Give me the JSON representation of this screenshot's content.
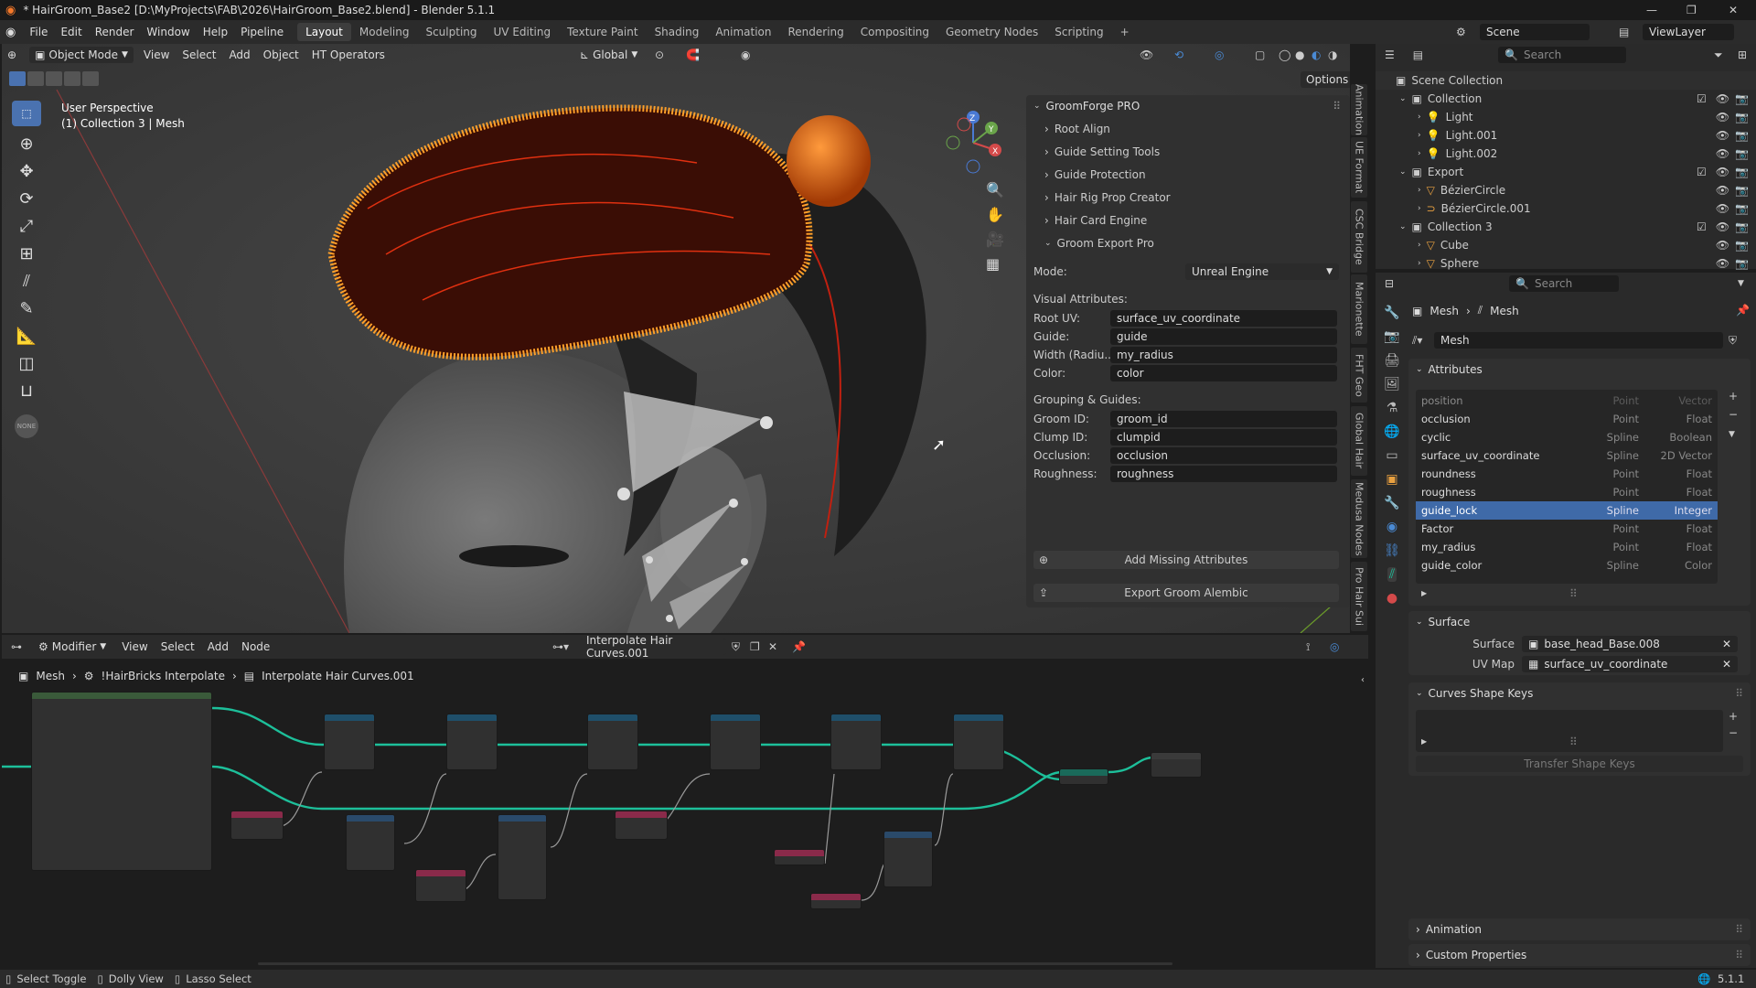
{
  "window": {
    "title": "* HairGroom_Base2 [D:\\MyProjects\\FAB\\2026\\HairGroom_Base2.blend] - Blender 5.1.1"
  },
  "menu": [
    "File",
    "Edit",
    "Render",
    "Window",
    "Help",
    "Pipeline"
  ],
  "workspaces": [
    "Layout",
    "Modeling",
    "Sculpting",
    "UV Editing",
    "Texture Paint",
    "Shading",
    "Animation",
    "Rendering",
    "Compositing",
    "Geometry Nodes",
    "Scripting"
  ],
  "topright": {
    "scene": "Scene",
    "viewlayer": "ViewLayer"
  },
  "viewport": {
    "mode": "Object Mode",
    "menus": [
      "View",
      "Select",
      "Add",
      "Object",
      "HT Operators"
    ],
    "transform": "Global",
    "options": "Options",
    "overlay_title": "User Perspective",
    "overlay_sub": "(1) Collection 3 | Mesh",
    "none_label": "NONE"
  },
  "groomforge": {
    "title": "GroomForge PRO",
    "sections": [
      "Root Align",
      "Guide Setting Tools",
      "Guide Protection",
      "Hair Rig Prop Creator",
      "Hair Card Engine"
    ],
    "export_title": "Groom Export Pro",
    "mode_label": "Mode:",
    "mode_value": "Unreal Engine",
    "visual_title": "Visual Attributes:",
    "visual": [
      {
        "k": "Root UV:",
        "v": "surface_uv_coordinate"
      },
      {
        "k": "Guide:",
        "v": "guide"
      },
      {
        "k": "Width (Radiu...",
        "v": "my_radius"
      },
      {
        "k": "Color:",
        "v": "color"
      }
    ],
    "grouping_title": "Grouping & Guides:",
    "grouping": [
      {
        "k": "Groom ID:",
        "v": "groom_id"
      },
      {
        "k": "Clump ID:",
        "v": "clumpid"
      },
      {
        "k": "Occlusion:",
        "v": "occlusion"
      },
      {
        "k": "Roughness:",
        "v": "roughness"
      }
    ],
    "add_missing": "Add Missing Attributes",
    "export": "Export Groom Alembic"
  },
  "side_tabs": [
    "Animation",
    "UE Format",
    "CSC Bridge",
    "Marionette",
    "FHT Geo",
    "Global Hair",
    "Medusa Nodes",
    "Pro Hair Sui"
  ],
  "outliner": {
    "search": "Search",
    "root": "Scene Collection",
    "items": [
      {
        "name": "Collection",
        "level": 1
      },
      {
        "name": "Light",
        "level": 2
      },
      {
        "name": "Light.001",
        "level": 2
      },
      {
        "name": "Light.002",
        "level": 2
      },
      {
        "name": "Export",
        "level": 1
      },
      {
        "name": "BézierCircle",
        "level": 2
      },
      {
        "name": "BézierCircle.001",
        "level": 2
      },
      {
        "name": "Collection 3",
        "level": 1
      },
      {
        "name": "Cube",
        "level": 2
      },
      {
        "name": "Sphere",
        "level": 2
      }
    ]
  },
  "properties": {
    "search": "Search",
    "breadcrumb": [
      "Mesh",
      "Mesh"
    ],
    "datablock": "Mesh",
    "attributes_title": "Attributes",
    "attributes": [
      {
        "n": "position",
        "d": "Point",
        "t": "Vector"
      },
      {
        "n": "occlusion",
        "d": "Point",
        "t": "Float"
      },
      {
        "n": "cyclic",
        "d": "Spline",
        "t": "Boolean"
      },
      {
        "n": "surface_uv_coordinate",
        "d": "Spline",
        "t": "2D Vector"
      },
      {
        "n": "roundness",
        "d": "Point",
        "t": "Float"
      },
      {
        "n": "roughness",
        "d": "Point",
        "t": "Float"
      },
      {
        "n": "guide_lock",
        "d": "Spline",
        "t": "Integer"
      },
      {
        "n": "Factor",
        "d": "Point",
        "t": "Float"
      },
      {
        "n": "my_radius",
        "d": "Point",
        "t": "Float"
      },
      {
        "n": "guide_color",
        "d": "Spline",
        "t": "Color"
      }
    ],
    "surface_title": "Surface",
    "surface_label": "Surface",
    "surface_value": "base_head_Base.008",
    "uvmap_label": "UV Map",
    "uvmap_value": "surface_uv_coordinate",
    "shapekeys_title": "Curves Shape Keys",
    "transfer": "Transfer Shape Keys",
    "animation_title": "Animation",
    "custom_title": "Custom Properties"
  },
  "nodeeditor": {
    "type": "Modifier",
    "menus": [
      "View",
      "Select",
      "Add",
      "Node"
    ],
    "tree": "Interpolate Hair Curves.001",
    "breadcrumb": [
      "Mesh",
      "!HairBricks Interpolate",
      "Interpolate Hair Curves.001"
    ]
  },
  "status": {
    "items": [
      "Select Toggle",
      "Dolly View",
      "Lasso Select"
    ],
    "version": "5.1.1"
  }
}
